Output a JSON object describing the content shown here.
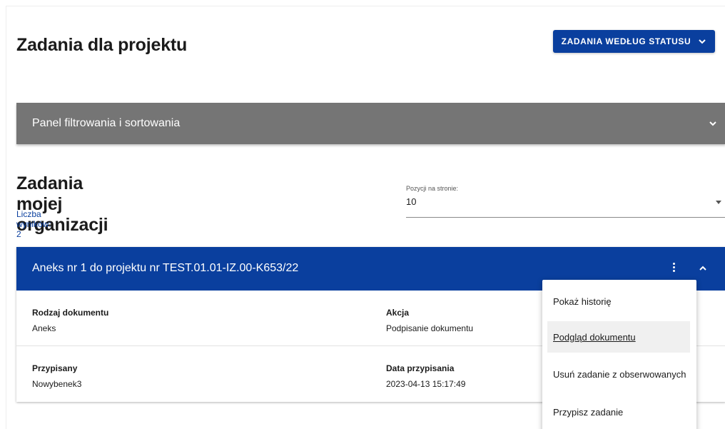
{
  "header": {
    "title": "Zadania dla projektu",
    "status_button_label": "ZADANIA WEDŁUG STATUSU"
  },
  "filter_panel": {
    "label": "Panel filtrowania i sortowania"
  },
  "section": {
    "title": "Zadania mojej organizacji",
    "results_label": "Liczba wyników: 2"
  },
  "per_page": {
    "label": "Pozycji na stronie:",
    "value": "10"
  },
  "task": {
    "title": "Aneks nr 1 do projektu nr TEST.01.01-IZ.00-K653/22",
    "rows": [
      {
        "left_label": "Rodzaj dokumentu",
        "left_value": "Aneks",
        "right_label": "Akcja",
        "right_value": "Podpisanie dokumentu"
      },
      {
        "left_label": "Przypisany",
        "left_value": "Nowybenek3",
        "right_label": "Data przypisania",
        "right_value": "2023-04-13 15:17:49"
      }
    ]
  },
  "context_menu": {
    "items": [
      {
        "label": "Pokaż historię"
      },
      {
        "label": "Podgląd dokumentu"
      },
      {
        "label": "Usuń zadanie z obserwowanych"
      },
      {
        "label": "Przypisz zadanie"
      }
    ]
  },
  "icons": {
    "status_chevron": "chevron-down-icon",
    "filter_chevron": "chevron-down-icon",
    "kebab": "more-vertical-icon",
    "collapse": "chevron-up-icon"
  },
  "colors": {
    "primary": "#0a3f9e",
    "filter_bar": "#757575",
    "menu_hover": "#f0f0f0"
  }
}
